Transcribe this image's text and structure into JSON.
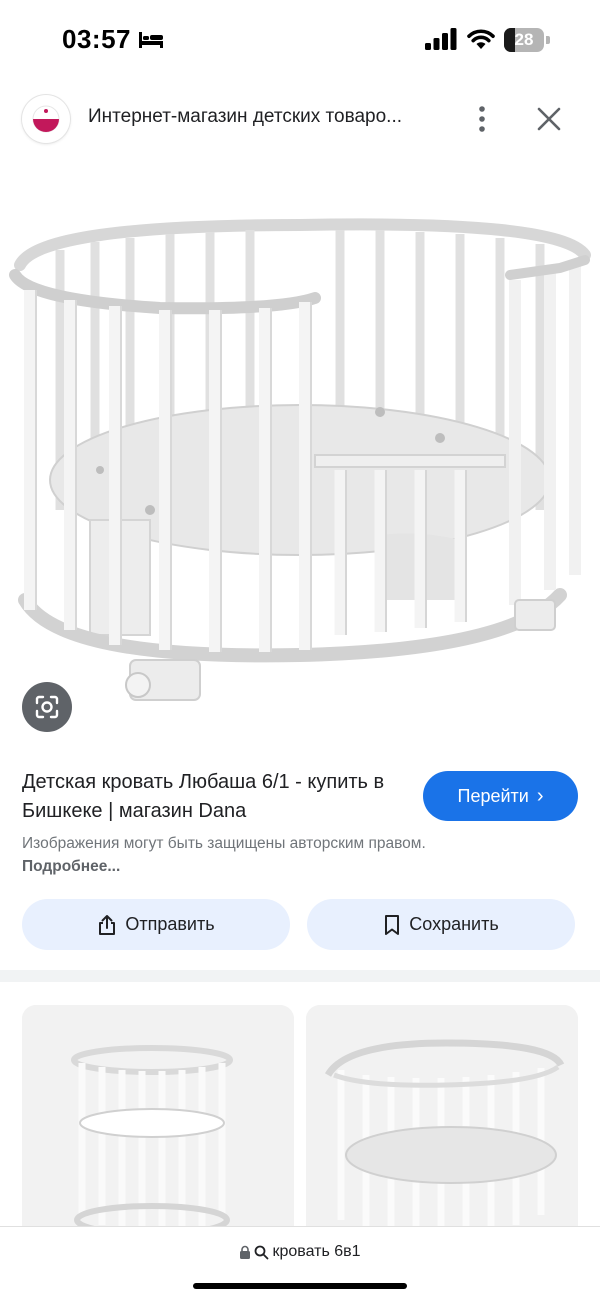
{
  "status_bar": {
    "time": "03:57",
    "battery_level": "28",
    "battery_fraction": 0.28,
    "icons": [
      "bed-icon",
      "signal-icon",
      "wifi-icon",
      "battery-icon"
    ]
  },
  "header": {
    "site_title": "Интернет-магазин детских товаро...",
    "icons": [
      "site-logo",
      "more-vertical-icon",
      "close-icon"
    ]
  },
  "result": {
    "title": "Детская кровать Любаша 6/1 - купить в Бишкеке | магазин Dana",
    "visit_label": "Перейти",
    "copyright_text": "Изображения могут быть защищены авторским правом.",
    "more_link": "Подробнее..."
  },
  "actions": {
    "share_label": "Отправить",
    "save_label": "Сохранить"
  },
  "bottom_bar": {
    "url_text": "кровать 6в1",
    "icons": [
      "lock-icon",
      "search-icon"
    ]
  },
  "colors": {
    "accent": "#1a73e8",
    "action_bg": "#e8f0fe",
    "text_primary": "#202124",
    "text_secondary": "#70757a",
    "logo_color": "#c2185b"
  }
}
